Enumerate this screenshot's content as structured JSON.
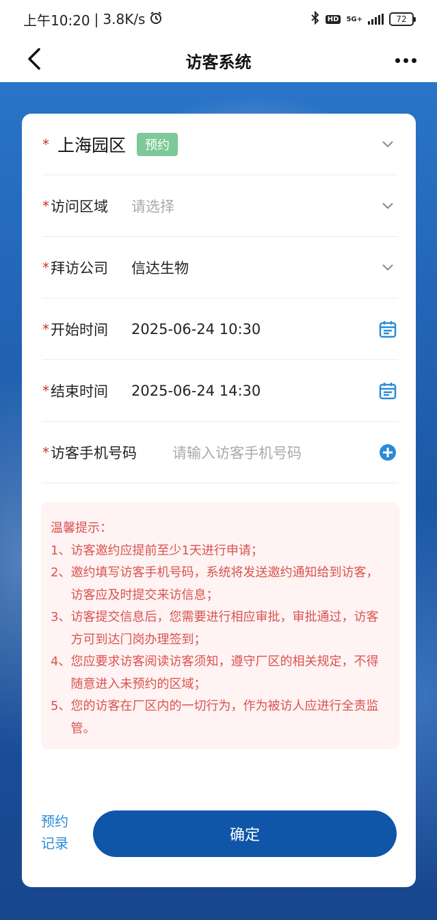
{
  "status_bar": {
    "time": "上午10:20",
    "speed": "3.8K/s",
    "alarm_icon": "alarm-clock-icon",
    "bluetooth_icon": "bluetooth-icon",
    "hd": "HD",
    "network": "5G+",
    "battery": "72"
  },
  "nav": {
    "title": "访客系统",
    "back_icon": "chevron-left-icon",
    "more_icon": "more-dots-icon"
  },
  "form": {
    "park": {
      "required_mark": "*",
      "name": "上海园区",
      "tag": "预约"
    },
    "visit_area": {
      "required_mark": "*",
      "label": "访问区域",
      "placeholder": "请选择"
    },
    "company": {
      "required_mark": "*",
      "label": "拜访公司",
      "value": "信达生物"
    },
    "start_time": {
      "required_mark": "*",
      "label": "开始时间",
      "value": "2025-06-24 10:30"
    },
    "end_time": {
      "required_mark": "*",
      "label": "结束时间",
      "value": "2025-06-24 14:30"
    },
    "phone": {
      "required_mark": "*",
      "label": "访客手机号码",
      "placeholder": "请输入访客手机号码"
    }
  },
  "tips": {
    "title": "温馨提示：",
    "items": [
      {
        "num": "1、",
        "text": "访客邀约应提前至少1天进行申请；"
      },
      {
        "num": "2、",
        "text": "邀约填写访客手机号码，系统将发送邀约通知给到访客，访客应及时提交来访信息；"
      },
      {
        "num": "3、",
        "text": "访客提交信息后，您需要进行相应审批，审批通过，访客方可到达门岗办理签到；"
      },
      {
        "num": "4、",
        "text": "您应要求访客阅读访客须知，遵守厂区的相关规定，不得随意进入未预约的区域；"
      },
      {
        "num": "5、",
        "text": "您的访客在厂区内的一切行为，作为被访人应进行全责监管。"
      }
    ]
  },
  "bottom": {
    "records_link": "预约记录",
    "confirm_label": "确定"
  },
  "colors": {
    "primary": "#0f55a8",
    "required": "#c9322b",
    "tag": "#7dc997",
    "tips_text": "#d9534f",
    "icon_blue": "#2a8bd6"
  }
}
